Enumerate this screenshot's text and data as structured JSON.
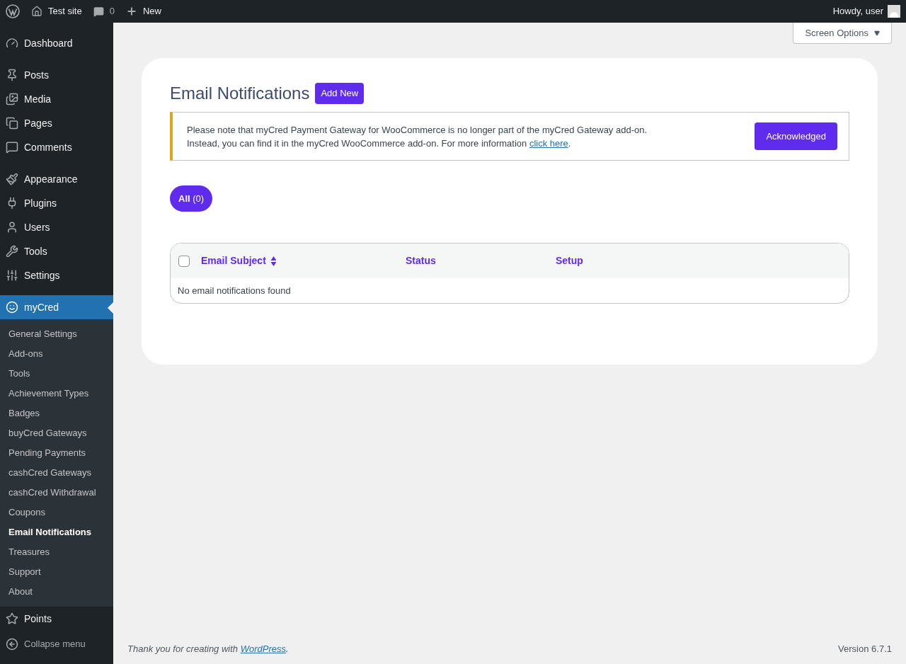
{
  "admin_bar": {
    "site": "Test site",
    "comments": "0",
    "new": "New",
    "greeting": "Howdy, user"
  },
  "menu": [
    [
      {
        "label": "Dashboard",
        "selected": false
      }
    ],
    [
      {
        "label": "Posts",
        "selected": false
      },
      {
        "label": "Media",
        "selected": false
      },
      {
        "label": "Pages",
        "selected": false
      },
      {
        "label": "Comments",
        "selected": false
      }
    ],
    [
      {
        "label": "Appearance",
        "selected": false
      },
      {
        "label": "Plugins",
        "selected": false
      },
      {
        "label": "Users",
        "selected": false
      },
      {
        "label": "Tools",
        "selected": false
      },
      {
        "label": "Settings",
        "selected": false
      }
    ],
    [
      {
        "label": "myCred",
        "selected": true,
        "children": [
          {
            "label": "General Settings",
            "selected": false
          },
          {
            "label": "Add-ons",
            "selected": false
          },
          {
            "label": "Tools",
            "selected": false
          },
          {
            "label": "Achievement Types",
            "selected": false
          },
          {
            "label": "Badges",
            "selected": false
          },
          {
            "label": "buyCred Gateways",
            "selected": false
          },
          {
            "label": "Pending Payments",
            "selected": false
          },
          {
            "label": "cashCred Gateways",
            "selected": false
          },
          {
            "label": "cashCred Withdrawal",
            "selected": false
          },
          {
            "label": "Coupons",
            "selected": false
          },
          {
            "label": "Email Notifications",
            "selected": true
          },
          {
            "label": "Treasures",
            "selected": false
          },
          {
            "label": "Support",
            "selected": false
          },
          {
            "label": "About",
            "selected": false
          }
        ]
      },
      {
        "label": "Points",
        "selected": false
      }
    ]
  ],
  "collapse": "Collapse menu",
  "screen_options": "Screen Options",
  "page": {
    "title": "Email Notifications",
    "add_new": "Add New",
    "notice": {
      "text": "Please note that myCred Payment Gateway for WooCommerce is no longer part of the myCred Gateway add-on. Instead, you can find it in the myCred WooCommerce add-on. For more information ",
      "link": "click here",
      "after": ".",
      "button": "Acknowledged"
    },
    "filters": [
      {
        "label": "All",
        "count": "(0)",
        "selected": true
      }
    ],
    "table": {
      "select_all_checked": false,
      "columns": [
        {
          "label": "Email Subject",
          "sortable": true
        },
        {
          "label": "Status",
          "sortable": false
        },
        {
          "label": "Setup",
          "sortable": false
        }
      ],
      "empty": "No email notifications found"
    }
  },
  "footer": {
    "text": "Thank you for creating with ",
    "link": "WordPress",
    "after": ".",
    "version": "Version 6.7.1"
  }
}
